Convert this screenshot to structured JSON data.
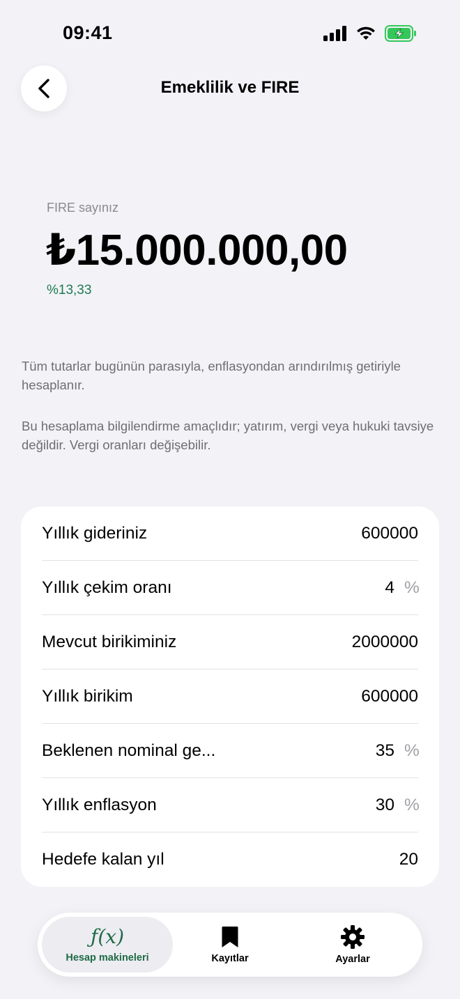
{
  "status": {
    "time": "09:41",
    "battery_color": "#34c759"
  },
  "nav": {
    "title": "Emeklilik ve FIRE",
    "back_icon": "chevron-left-icon"
  },
  "hero": {
    "label": "FIRE sayınız",
    "value": "₺15.000.000,00",
    "rate": "%13,33",
    "rate_color": "#1f7a4f"
  },
  "notes": [
    "Tüm tutarlar bugünün parasıyla, enflasyondan arındırılmış getiriyle hesaplanır.",
    "Bu hesaplama bilgilendirme amaçlıdır; yatırım, vergi veya hukuki tavsiye değildir. Vergi oranları değişebilir."
  ],
  "fields": [
    {
      "label": "Yıllık gideriniz",
      "value": "600000",
      "unit": ""
    },
    {
      "label": "Yıllık çekim oranı",
      "value": "4",
      "unit": "%"
    },
    {
      "label": "Mevcut birikiminiz",
      "value": "2000000",
      "unit": ""
    },
    {
      "label": "Yıllık birikim",
      "value": "600000",
      "unit": ""
    },
    {
      "label": "Beklenen nominal ge...",
      "value": "35",
      "unit": "%"
    },
    {
      "label": "Yıllık enflasyon",
      "value": "30",
      "unit": "%"
    },
    {
      "label": "Hedefe kalan yıl",
      "value": "20",
      "unit": ""
    }
  ],
  "tabs": [
    {
      "label": "Hesap makineleri",
      "icon": "function-icon",
      "icon_text": "ƒ(x)",
      "active": true
    },
    {
      "label": "Kayıtlar",
      "icon": "bookmark-icon",
      "active": false
    },
    {
      "label": "Ayarlar",
      "icon": "gear-icon",
      "active": false
    }
  ],
  "accent": "#1f6b45"
}
